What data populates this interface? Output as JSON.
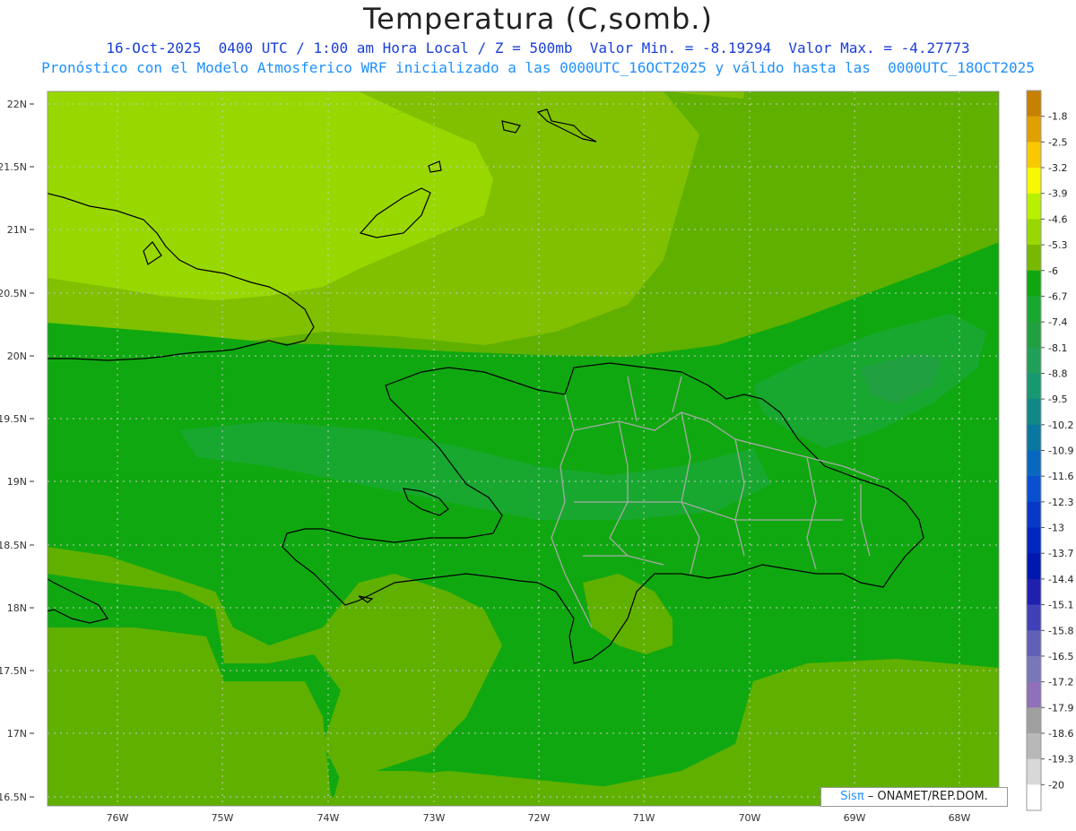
{
  "title": "Temperatura (C,somb.)",
  "subtitle_line1": "16-Oct-2025  0400 UTC / 1:00 am Hora Local / Z = 500mb  Valor Min. = -8.19294  Valor Max. = -4.27773",
  "subtitle_line2": "Pronóstico con el Modelo Atmosferico WRF inicializado a las 0000UTC_16OCT2025 y válido hasta las  0000UTC_18OCT2025",
  "map": {
    "lat_labels": [
      "22N",
      "21.5N",
      "21N",
      "20.5N",
      "20N",
      "19.5N",
      "19N",
      "18.5N",
      "18N",
      "17.5N",
      "17N",
      "16.5N"
    ],
    "lon_labels": [
      "76W",
      "75W",
      "74W",
      "73W",
      "72W",
      "71W",
      "70W",
      "69W",
      "68W"
    ],
    "colors": {
      "land_outline": "#000000",
      "province_lines": "#a8a8a8",
      "grid_lines": "#c8c8c8"
    }
  },
  "colorbar": {
    "labels": [
      "-1.8",
      "-2.5",
      "-3.2",
      "-3.9",
      "-4.6",
      "-5.3",
      "-6",
      "-6.7",
      "-7.4",
      "-8.1",
      "-8.8",
      "-9.5",
      "-10.2",
      "-10.9",
      "-11.6",
      "-12.3",
      "-13",
      "-13.7",
      "-14.4",
      "-15.1",
      "-15.8",
      "-16.5",
      "-17.2",
      "-17.9",
      "-18.6",
      "-19.3",
      "-20"
    ],
    "colors": [
      "#c88000",
      "#e0a000",
      "#f8c800",
      "#f8f800",
      "#b8f000",
      "#98d800",
      "#78b800",
      "#10a810",
      "#18a830",
      "#20a040",
      "#20a058",
      "#189870",
      "#108888",
      "#0878a0",
      "#0868c0",
      "#0850d0",
      "#0838c8",
      "#0028c0",
      "#0018b0",
      "#2020b0",
      "#4040b8",
      "#6060b8",
      "#7878b8",
      "#9070b8",
      "#a0a0a0",
      "#b8b8b8",
      "#d8d8d8",
      "#ffffff"
    ]
  },
  "field": {
    "colors": {
      "band_-4.6": "#98d800",
      "band_-5.3": "#80c000",
      "band_-6": "#60b000",
      "band_-6.7": "#10a810",
      "band_-7.4": "#18a830",
      "band_-8.1": "#20a040"
    }
  },
  "credit": {
    "brand": "Sisπ",
    "org": " – ONAMET/REP.DOM."
  }
}
